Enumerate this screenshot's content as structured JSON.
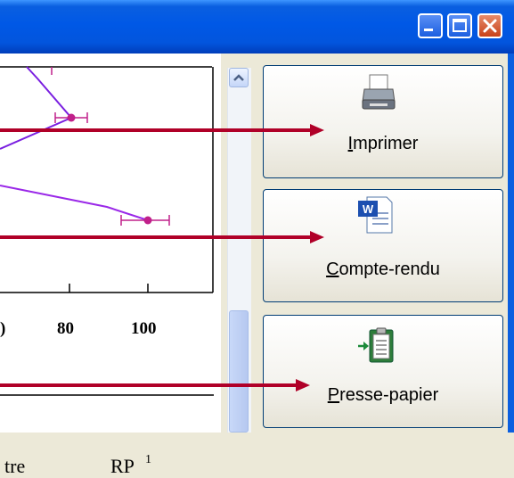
{
  "buttons": {
    "print": {
      "mnemonic": "I",
      "rest": "mprimer",
      "icon": "printer-icon"
    },
    "report": {
      "mnemonic": "C",
      "rest": "ompte-rendu",
      "icon": "word-document-icon"
    },
    "clipboard": {
      "mnemonic": "P",
      "rest": "resse-papier",
      "icon": "clipboard-icon"
    }
  },
  "chart": {
    "tick_labels": [
      ")",
      "80",
      "100"
    ],
    "footer_text": [
      "tre",
      "RP"
    ],
    "footer_superscript": "1"
  },
  "colors": {
    "arrow": "#b00028",
    "line_top": "#7a1fe0",
    "line_bottom": "#9a28e8",
    "errorbar": "#c0208a"
  }
}
